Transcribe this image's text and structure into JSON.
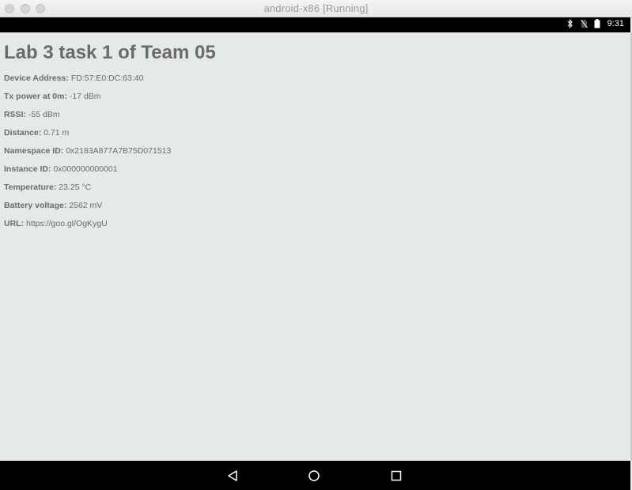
{
  "window": {
    "title": "android-x86 [Running]"
  },
  "status_bar": {
    "time": "9:31",
    "icons": [
      "bluetooth-icon",
      "no-sim-icon",
      "battery-icon"
    ]
  },
  "app": {
    "heading": "Lab 3 task 1 of Team 05",
    "fields": [
      {
        "label": "Device Address:",
        "value": "FD:57:E0:DC:63:40"
      },
      {
        "label": "Tx power at 0m:",
        "value": "-17 dBm"
      },
      {
        "label": "RSSI:",
        "value": "-55 dBm"
      },
      {
        "label": "Distance:",
        "value": "0.71 m"
      },
      {
        "label": "Namespace ID:",
        "value": "0x2183A877A7B75D071513"
      },
      {
        "label": "Instance ID:",
        "value": "0x000000000001"
      },
      {
        "label": "Temperature:",
        "value": "23.25 °C"
      },
      {
        "label": "Battery voltage:",
        "value": "2562 mV"
      },
      {
        "label": "URL:",
        "value": "https://goo.gl/OgKygU"
      }
    ]
  },
  "nav_bar": {
    "buttons": [
      "back-icon",
      "home-icon",
      "recents-icon"
    ]
  },
  "colors": {
    "content_background": "#e6eae6",
    "text": "#6b6b6b",
    "system_bars": "#000000"
  }
}
